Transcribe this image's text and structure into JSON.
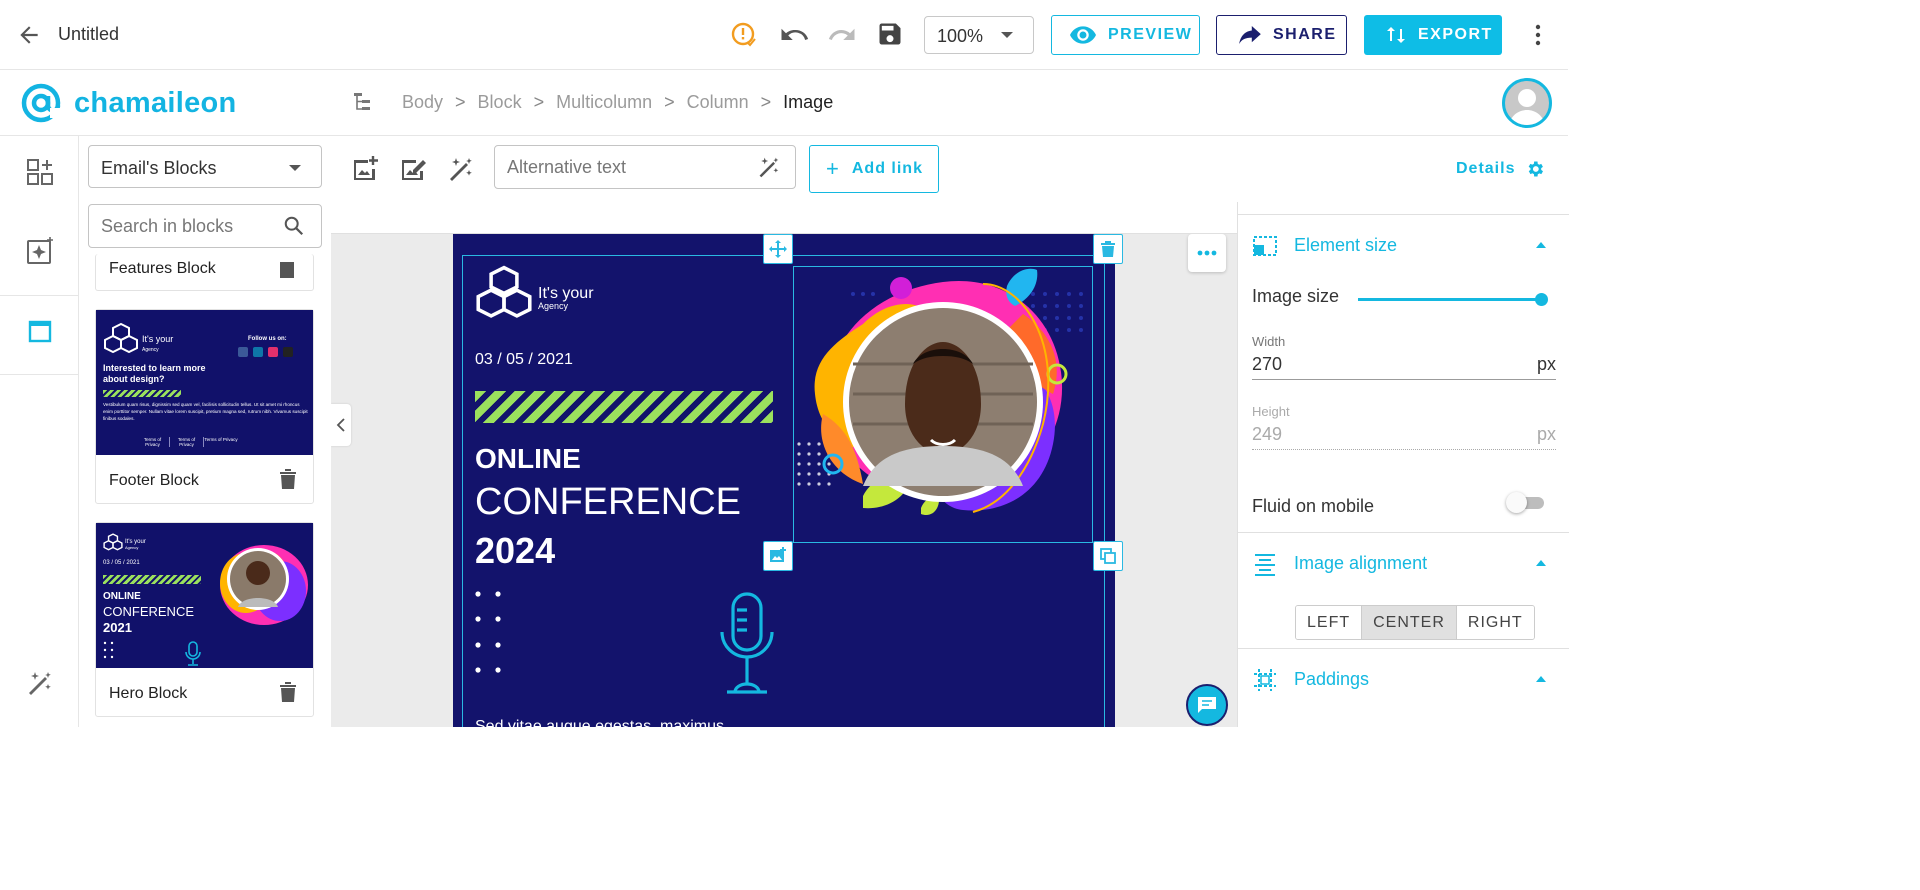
{
  "header": {
    "title": "Untitled",
    "zoom": "100%",
    "preview_label": "PREVIEW",
    "share_label": "SHARE",
    "export_label": "EXPORT"
  },
  "brand": {
    "name": "chamaileon"
  },
  "breadcrumb": [
    "Body",
    "Block",
    "Multicolumn",
    "Column",
    "Image"
  ],
  "blocks_panel": {
    "category": "Email's Blocks",
    "search_placeholder": "Search in blocks",
    "items": [
      {
        "name": "Features Block"
      },
      {
        "name": "Footer Block"
      },
      {
        "name": "Hero Block"
      }
    ],
    "footer_thumb": {
      "brand": "It's your",
      "brand_sub": "Agency",
      "follow": "Follow us on:",
      "headline": "Interested to learn more about design?",
      "body": "Vestibulum quam risus, dignissim sed quam vel, facilisis sollicitudin tellus. Ut sit amet mi rhoncus enim porttitor semper. Nullam vitae lorem suscipit, pretium magna sed, rutrum nibh. Vivamus suscipit finibus sodales.",
      "links": [
        "Terms of Privacy",
        "Terms of Privacy",
        "Terms of Privacy"
      ]
    },
    "hero_thumb": {
      "brand": "It's your",
      "brand_sub": "Agency",
      "date": "03 / 05 / 2021",
      "line1": "ONLINE",
      "line2": "CONFERENCE",
      "line3": "2021"
    }
  },
  "image_toolbar": {
    "alt_placeholder": "Alternative text",
    "add_link_label": "Add link",
    "details_label": "Details"
  },
  "email": {
    "brand": "It's your",
    "brand_sub": "Agency",
    "date": "03 / 05 / 2021",
    "line1": "ONLINE",
    "line2": "CONFERENCE",
    "line3": "2024",
    "body_partial": "Sed vitae augue egestas, maximus"
  },
  "right_panel": {
    "element_size_label": "Element size",
    "image_size_label": "Image size",
    "image_size_fraction": 1.0,
    "width_label": "Width",
    "width_value": "270",
    "width_unit": "px",
    "height_label": "Height",
    "height_value": "249",
    "height_unit": "px",
    "fluid_label": "Fluid on mobile",
    "fluid_on": false,
    "alignment_label": "Image alignment",
    "alignment_options": [
      "LEFT",
      "CENTER",
      "RIGHT"
    ],
    "alignment_selected": "CENTER",
    "paddings_label": "Paddings"
  },
  "colors": {
    "accent": "#14b8e0",
    "navy": "#1b1f6e",
    "email_bg": "#13136c",
    "stripe": "#9be15d"
  }
}
